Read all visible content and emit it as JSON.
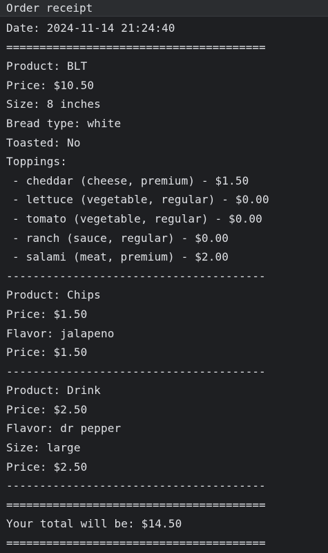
{
  "receipt": {
    "title": "Order receipt",
    "date_line": "Date: 2024-11-14 21:24:40",
    "separator_double": "=======================================",
    "separator_single": "---------------------------------------",
    "items": [
      {
        "product_line": "Product: BLT",
        "price_line": "Price: $10.50",
        "size_line": "Size: 8 inches",
        "bread_line": "Bread type: white",
        "toasted_line": "Toasted: No",
        "toppings_label": "Toppings:",
        "toppings": [
          "- cheddar (cheese, premium) - $1.50",
          "- lettuce (vegetable, regular) - $0.00",
          "- tomato (vegetable, regular) - $0.00",
          "- ranch (sauce, regular) - $0.00",
          "- salami (meat, premium) - $2.00"
        ]
      },
      {
        "product_line": "Product: Chips",
        "price_line": "Price: $1.50",
        "flavor_line": "Flavor: jalapeno",
        "price_line_2": "Price: $1.50"
      },
      {
        "product_line": "Product: Drink",
        "price_line": "Price: $2.50",
        "flavor_line": "Flavor: dr pepper",
        "size_line": "Size: large",
        "price_line_2": "Price: $2.50"
      }
    ],
    "total_line": "Your total will be: $14.50"
  }
}
